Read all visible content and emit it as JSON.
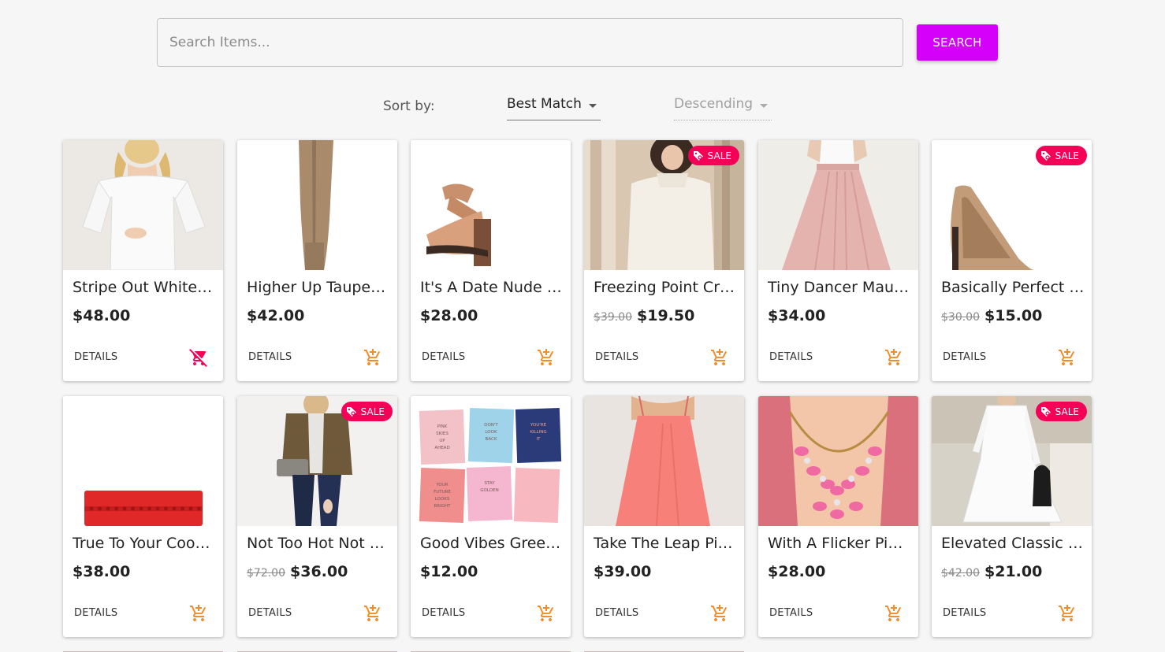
{
  "search": {
    "placeholder": "Search Items...",
    "button_label": "SEARCH"
  },
  "sort": {
    "label": "Sort by:",
    "field_value": "Best Match",
    "order_value": "Descending"
  },
  "products": [
    {
      "title": "Stripe Out White …",
      "price": "$48.00",
      "original_price": "",
      "sale": false,
      "cart_icon": "remove-from-cart-icon"
    },
    {
      "title": "Higher Up Taupe…",
      "price": "$42.00",
      "original_price": "",
      "sale": false,
      "cart_icon": "add-to-cart-icon"
    },
    {
      "title": "It's A Date Nude …",
      "price": "$28.00",
      "original_price": "",
      "sale": false,
      "cart_icon": "add-to-cart-icon"
    },
    {
      "title": "Freezing Point Cr…",
      "price": "$19.50",
      "original_price": "$39.00",
      "sale": true,
      "cart_icon": "add-to-cart-icon"
    },
    {
      "title": "Tiny Dancer Mau…",
      "price": "$34.00",
      "original_price": "",
      "sale": false,
      "cart_icon": "add-to-cart-icon"
    },
    {
      "title": "Basically Perfect …",
      "price": "$15.00",
      "original_price": "$30.00",
      "sale": true,
      "cart_icon": "add-to-cart-icon"
    },
    {
      "title": "True To Your Coo…",
      "price": "$38.00",
      "original_price": "",
      "sale": false,
      "cart_icon": "add-to-cart-icon"
    },
    {
      "title": "Not Too Hot Not …",
      "price": "$36.00",
      "original_price": "$72.00",
      "sale": true,
      "cart_icon": "add-to-cart-icon"
    },
    {
      "title": "Good Vibes Gree…",
      "price": "$12.00",
      "original_price": "",
      "sale": false,
      "cart_icon": "add-to-cart-icon"
    },
    {
      "title": "Take The Leap Pi…",
      "price": "$39.00",
      "original_price": "",
      "sale": false,
      "cart_icon": "add-to-cart-icon"
    },
    {
      "title": "With A Flicker Pi…",
      "price": "$28.00",
      "original_price": "",
      "sale": false,
      "cart_icon": "add-to-cart-icon"
    },
    {
      "title": "Elevated Classic …",
      "price": "$21.00",
      "original_price": "$42.00",
      "sale": true,
      "cart_icon": "add-to-cart-icon"
    }
  ],
  "card_labels": {
    "details": "DETAILS",
    "sale": "SALE"
  },
  "greeting_cards_text": [
    "PINK SKIES UP AHEAD",
    "DON'T LOOK BACK",
    "YOU'RE KILLING IT",
    "YOUR FUTURE LOOKS BRIGHT",
    "STAY GOLDEN"
  ],
  "colors": {
    "accent": "#d500f9",
    "sale": "#f50057",
    "cart": "#f28c28",
    "remove": "#f50057"
  }
}
